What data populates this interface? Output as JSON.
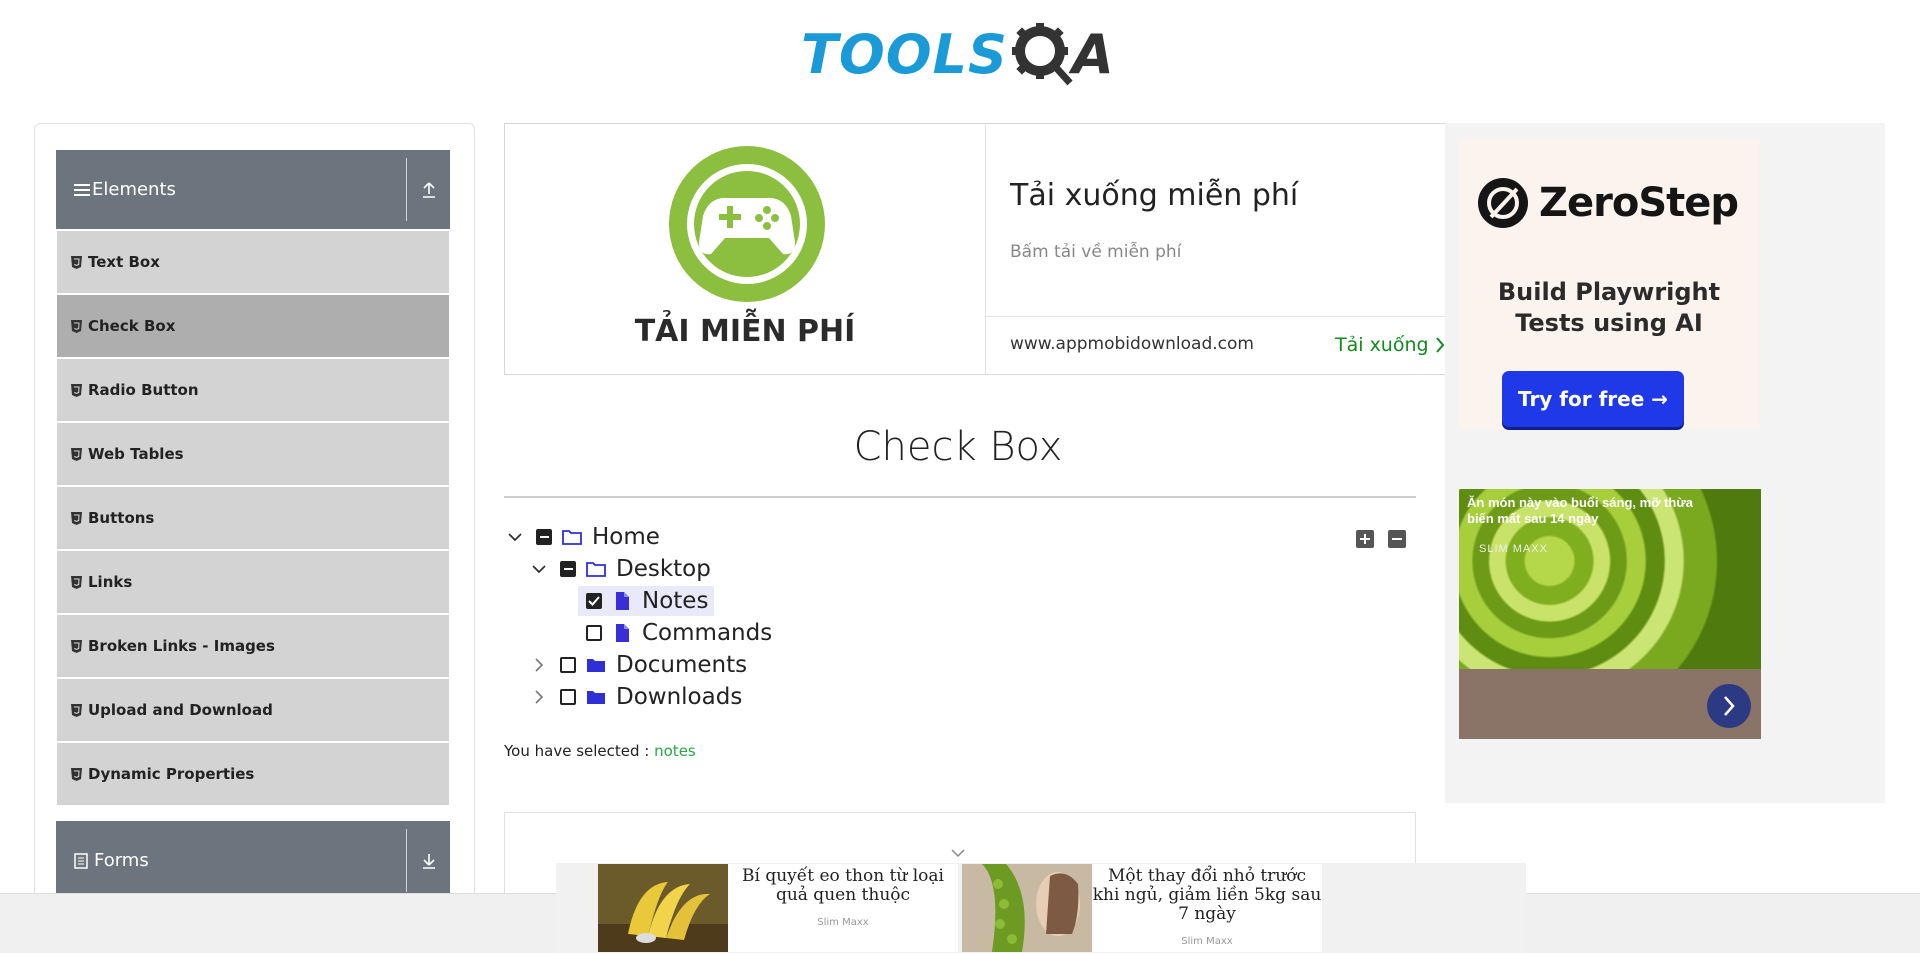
{
  "header": {
    "logo_text_tools": "TOOLS",
    "logo_text_a": "A"
  },
  "sidebar": {
    "group_elements": "Elements",
    "items": [
      {
        "label": "Text Box"
      },
      {
        "label": "Check Box"
      },
      {
        "label": "Radio Button"
      },
      {
        "label": "Web Tables"
      },
      {
        "label": "Buttons"
      },
      {
        "label": "Links"
      },
      {
        "label": "Broken Links - Images"
      },
      {
        "label": "Upload and Download"
      },
      {
        "label": "Dynamic Properties"
      }
    ],
    "group_forms": "Forms",
    "active_item": "Check Box"
  },
  "ad_top": {
    "free_label": "TẢI MIỄN PHÍ",
    "title": "Tải xuống miễn phí",
    "subtitle": "Bấm tải về miễn phí",
    "url": "www.appmobidownload.com",
    "download": "Tải xuống"
  },
  "main": {
    "title": "Check Box",
    "tree": {
      "home": "Home",
      "desktop": "Desktop",
      "notes": "Notes",
      "commands": "Commands",
      "documents": "Documents",
      "downloads": "Downloads"
    },
    "result_prefix": "You have selected :",
    "result_value": "notes"
  },
  "ad_right": {
    "brand": "ZeroStep",
    "tagline_line1": "Build Playwright",
    "tagline_line2": "Tests using AI",
    "cta": "Try for free →",
    "promo_caption": "Ăn món này vào buổi sáng, mỡ thừa biến mất sau 14 ngày",
    "promo_brand": "SLIM MAXX"
  },
  "bottom_ads": [
    {
      "text": "Bí quyết eo thon từ loại quả quen thuộc",
      "source": "Slim Maxx"
    },
    {
      "text": "Một thay đổi nhỏ trước khi ngủ, giảm liền 5kg sau 7 ngày",
      "source": "Slim Maxx"
    }
  ],
  "colors": {
    "accent_blue": "#1a9ad6",
    "header_gray": "#6c757d",
    "menu_gray": "#d3d3d3",
    "active_menu": "#aeaeae",
    "success_green": "#28a745",
    "zerostep_blue": "#1f39e8"
  },
  "icons": {
    "menu": "hamburger-icon",
    "collapse": "upload-arrow-icon",
    "expand": "download-arrow-icon",
    "item": "html5-badge-icon",
    "folder": "folder-icon",
    "file": "file-icon",
    "expand_all": "plus-square-icon",
    "collapse_all": "minus-square-icon",
    "caret_down": "chevron-down-icon",
    "caret_right": "chevron-right-icon",
    "ad_arrow": "chevron-right-icon"
  }
}
